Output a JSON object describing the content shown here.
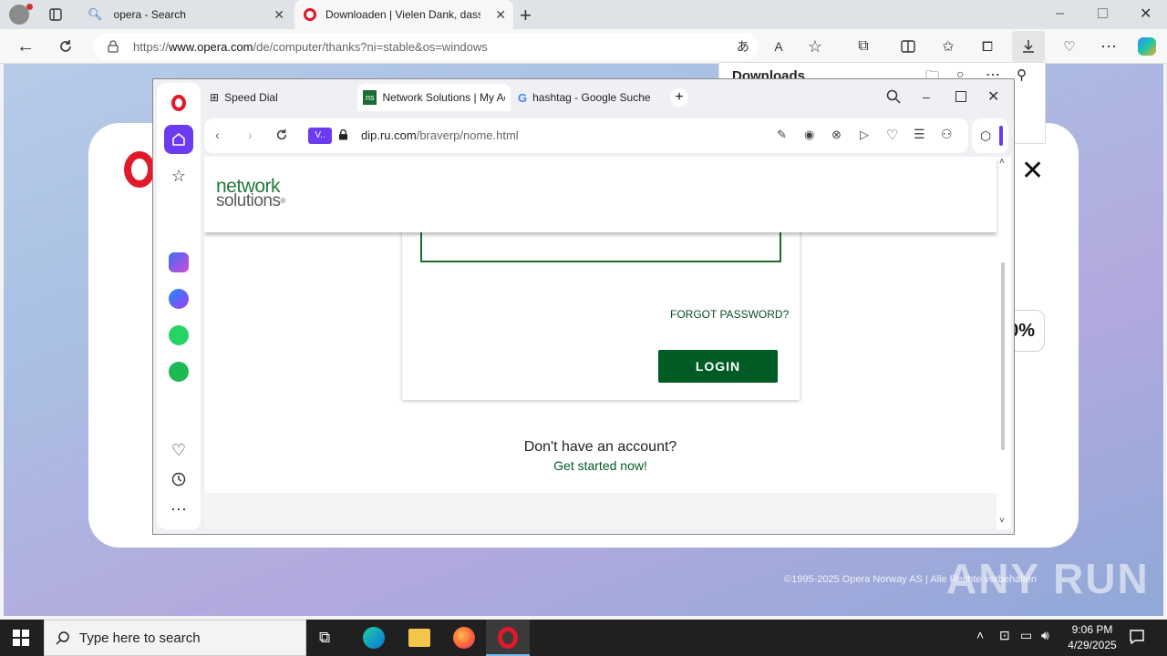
{
  "edge": {
    "tabs": [
      {
        "title": "opera - Search"
      },
      {
        "title": "Downloaden | Vielen Dank, dass Sie"
      }
    ],
    "address_prefix": "https://",
    "address_domain": "www.opera.com",
    "address_path": "/de/computer/thanks?ni=stable&os=windows",
    "downloads_title": "Downloads"
  },
  "opera_page": {
    "percent_fragment": "0%",
    "copyright": "©1995-2025 Opera Norway AS | Alle Rechte vorbehalten"
  },
  "opera_window": {
    "tabs": [
      {
        "title": "Speed Dial"
      },
      {
        "title": "Network Solutions | My Ac"
      },
      {
        "title": "hashtag - Google Suche"
      }
    ],
    "vpn_badge": "V..",
    "address_domain": "dip.ru.com",
    "address_path": "/braverp/nome.html"
  },
  "ns_page": {
    "logo_line1": "network",
    "logo_line2": "solutions",
    "logo_mark": "®",
    "forgot_password": "FORGOT PASSWORD?",
    "login_button": "LOGIN",
    "no_account": "Don't have an account?",
    "get_started": "Get started now!"
  },
  "taskbar": {
    "search_placeholder": "Type here to search",
    "time": "9:06 PM",
    "date": "4/29/2025"
  },
  "watermark": "ANY RUN",
  "colors": {
    "ns_green": "#005b25",
    "opera_red": "#e0192b",
    "opera_accent": "#6a3bf0"
  }
}
